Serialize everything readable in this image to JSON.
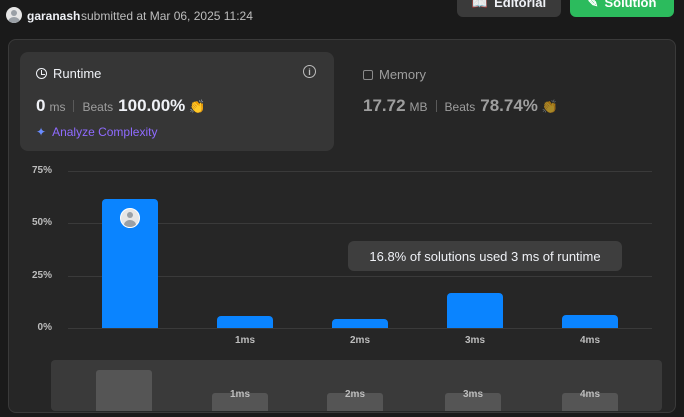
{
  "header": {
    "username": "garanash",
    "submitted_text": "submitted at Mar 06, 2025 11:24",
    "editorial_label": "Editorial",
    "solution_label": "Solution"
  },
  "runtime": {
    "title": "Runtime",
    "value": "0",
    "unit": "ms",
    "beats_label": "Beats",
    "beats_value": "100.00%",
    "analyze_label": "Analyze Complexity"
  },
  "memory": {
    "title": "Memory",
    "value": "17.72",
    "unit": "MB",
    "beats_label": "Beats",
    "beats_value": "78.74%"
  },
  "tooltip": {
    "text": "16.8% of solutions used 3 ms of runtime"
  },
  "colors": {
    "bar": "#0a84ff",
    "solution_button": "#2cbb5d",
    "accent_purple": "#8f6bff"
  },
  "chart_data": {
    "type": "bar",
    "categories": [
      "",
      "1ms",
      "2ms",
      "3ms",
      "4ms"
    ],
    "values": [
      61.5,
      5.5,
      4.5,
      16.8,
      6.0
    ],
    "ylim": [
      0,
      75
    ],
    "yticks": [
      "75%",
      "50%",
      "25%",
      "0%"
    ],
    "ytick_values": [
      75,
      50,
      25,
      0
    ],
    "grid": true
  },
  "minimap": {
    "labels": [
      "1ms",
      "2ms",
      "3ms",
      "4ms"
    ]
  }
}
